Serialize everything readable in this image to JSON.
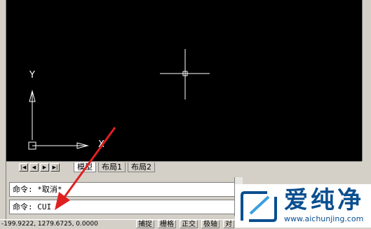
{
  "layout_tabs": {
    "model": "模型",
    "layout1": "布局1",
    "layout2": "布局2"
  },
  "nav_glyphs": {
    "first": "|◀",
    "prev": "◀",
    "next": "▶",
    "last": "▶|"
  },
  "ucs": {
    "y_label": "Y",
    "x_label": "X"
  },
  "command": {
    "line1": "命令: *取消*",
    "line2": "命令: CUI"
  },
  "status": {
    "coords": "-199.9222, 1279.6725, 0.0000",
    "buttons": [
      "捕捉",
      "栅格",
      "正交",
      "极轴",
      "对"
    ]
  },
  "watermark": {
    "title": "爱纯净",
    "url": "www.aichunjing.com"
  },
  "colors": {
    "canvas": "#000000",
    "arrow": "#e02020",
    "watermark_blue": "#0a4f8f"
  },
  "icons": [
    "crosshair-icon",
    "ucs-icon",
    "pointer-arrow-icon",
    "watermark-logo-icon"
  ]
}
